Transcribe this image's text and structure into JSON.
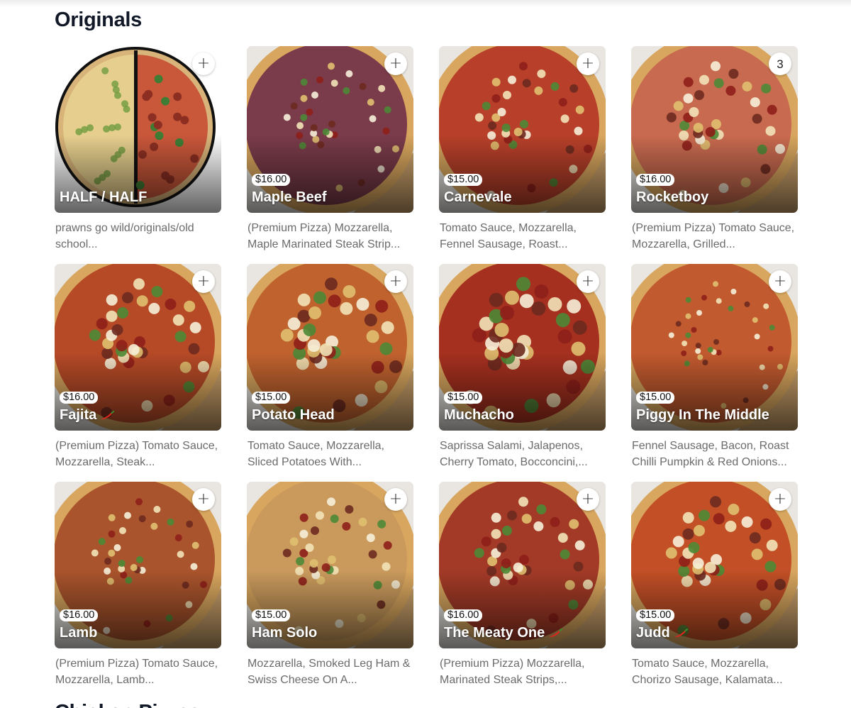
{
  "section": {
    "title": "Originals",
    "next_title": "Chicken Pizzas"
  },
  "icons": {
    "add": "plus-icon",
    "spicy": "chilli-icon"
  },
  "colors": {
    "accent": "#111827",
    "description": "#6b6b6b",
    "chilli": "#d7261e"
  },
  "items": [
    {
      "name": "HALF / HALF",
      "price": "",
      "description": "prawns go wild/originals/old school...",
      "button": "+",
      "spicy": false,
      "half": true,
      "tint": "#c9a45a"
    },
    {
      "name": "Maple Beef",
      "price": "$16.00",
      "description": "(Premium Pizza) Mozzarella, Maple Marinated Steak Strip...",
      "button": "+",
      "spicy": false,
      "tint": "#7a3b4a"
    },
    {
      "name": "Carnevale",
      "price": "$15.00",
      "description": "Tomato Sauce, Mozzarella, Fennel Sausage, Roast...",
      "button": "+",
      "spicy": false,
      "tint": "#b8402a"
    },
    {
      "name": "Rocketboy",
      "price": "$16.00",
      "description": "(Premium Pizza) Tomato Sauce, Mozzarella, Grilled...",
      "button": "3",
      "spicy": false,
      "tint": "#c86a4f"
    },
    {
      "name": "Fajita",
      "price": "$16.00",
      "description": "(Premium Pizza) Tomato Sauce, Mozzarella, Steak...",
      "button": "+",
      "spicy": true,
      "tint": "#b64a27"
    },
    {
      "name": "Potato Head",
      "price": "$15.00",
      "description": "Tomato Sauce, Mozzarella, Sliced Potatoes With...",
      "button": "+",
      "spicy": false,
      "tint": "#c0622e"
    },
    {
      "name": "Muchacho",
      "price": "$15.00",
      "description": "Saprissa Salami, Jalapenos, Cherry Tomato, Bocconcini,...",
      "button": "+",
      "spicy": false,
      "tint": "#a5301f"
    },
    {
      "name": "Piggy In The Middle",
      "price": "$15.00",
      "description": "Fennel Sausage, Bacon, Roast Chilli Pumpkin & Red Onions...",
      "button": "+",
      "spicy": false,
      "tint": "#c25a2f"
    },
    {
      "name": "Lamb",
      "price": "$16.00",
      "description": "(Premium Pizza) Tomato Sauce, Mozzarella, Lamb...",
      "button": "+",
      "spicy": false,
      "tint": "#a9542c"
    },
    {
      "name": "Ham Solo",
      "price": "$15.00",
      "description": "Mozzarella, Smoked Leg Ham & Swiss Cheese On A...",
      "button": "+",
      "spicy": false,
      "tint": "#c99a5c"
    },
    {
      "name": "The Meaty One",
      "price": "$16.00",
      "description": "(Premium Pizza) Mozzarella, Marinated Steak Strips,...",
      "button": "+",
      "spicy": true,
      "tint": "#a33a27"
    },
    {
      "name": "Judd",
      "price": "$15.00",
      "description": "Tomato Sauce, Mozzarella, Chorizo Sausage, Kalamata...",
      "button": "+",
      "spicy": true,
      "tint": "#c24f26"
    }
  ]
}
